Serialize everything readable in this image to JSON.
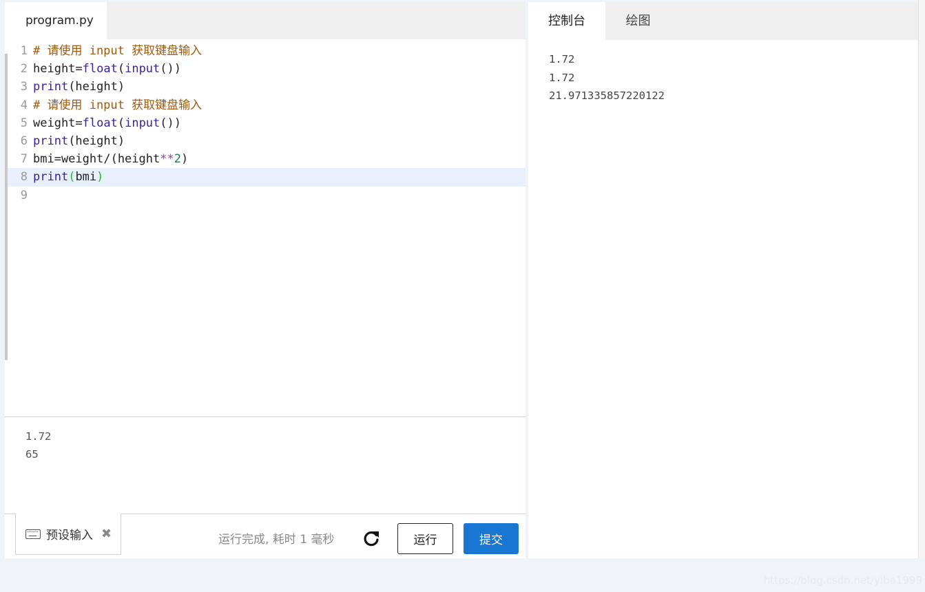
{
  "editor": {
    "file_tab": "program.py",
    "lines": [
      {
        "n": "1",
        "tokens": [
          [
            "comment",
            "# 请使用 input 获取键盘输入"
          ]
        ]
      },
      {
        "n": "2",
        "tokens": [
          [
            "plain",
            "height="
          ],
          [
            "builtin",
            "float"
          ],
          [
            "plain",
            "("
          ],
          [
            "builtin",
            "input"
          ],
          [
            "plain",
            "())"
          ]
        ]
      },
      {
        "n": "3",
        "tokens": [
          [
            "builtin",
            "print"
          ],
          [
            "plain",
            "(height)"
          ]
        ]
      },
      {
        "n": "4",
        "tokens": [
          [
            "comment",
            "# 请使用 input 获取键盘输入"
          ]
        ]
      },
      {
        "n": "5",
        "tokens": [
          [
            "plain",
            "weight="
          ],
          [
            "builtin",
            "float"
          ],
          [
            "plain",
            "("
          ],
          [
            "builtin",
            "input"
          ],
          [
            "plain",
            "())"
          ]
        ]
      },
      {
        "n": "6",
        "tokens": [
          [
            "builtin",
            "print"
          ],
          [
            "plain",
            "(height)"
          ]
        ]
      },
      {
        "n": "7",
        "tokens": [
          [
            "plain",
            "bmi=weight/(height"
          ],
          [
            "op",
            "**"
          ],
          [
            "num",
            "2"
          ],
          [
            "plain",
            ")"
          ]
        ]
      },
      {
        "n": "8",
        "active": true,
        "tokens": [
          [
            "builtin",
            "print"
          ],
          [
            "paren-hl",
            "("
          ],
          [
            "plain",
            "bmi"
          ],
          [
            "paren-hl",
            ")"
          ]
        ]
      },
      {
        "n": "9",
        "tokens": []
      }
    ]
  },
  "preset_input": {
    "lines": [
      "1.72",
      "65"
    ],
    "tab_label": "预设输入",
    "tab_icon": "keyboard-icon",
    "close_icon": "close-icon"
  },
  "toolbar": {
    "status": "运行完成, 耗时 1 毫秒",
    "refresh_icon": "refresh-icon",
    "run_label": "运行",
    "submit_label": "提交",
    "submit_color": "#1976d2"
  },
  "console": {
    "tabs": [
      "控制台",
      "绘图"
    ],
    "active_tab": 0,
    "output": [
      "1.72",
      "1.72",
      "21.971335857220122"
    ]
  },
  "watermark": "https://blog.csdn.net/yiba1999"
}
